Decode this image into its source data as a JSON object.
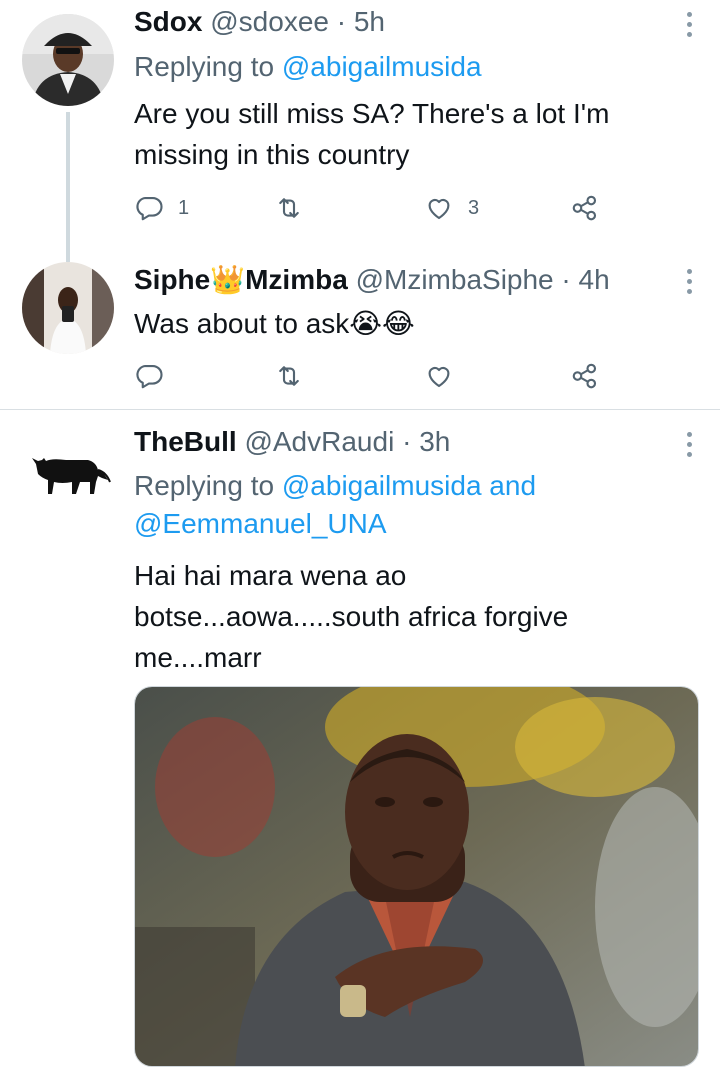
{
  "tweets": [
    {
      "name": "Sdox",
      "handle": "@sdoxee",
      "separator": "·",
      "time": "5h",
      "replying_prefix": "Replying to",
      "replying_to": "@abigailmusida",
      "text_line1": "Are you still miss SA? There's a lot I'm",
      "text_line2": "missing in this country",
      "reply_count": "1",
      "retweet_count": "",
      "like_count": "3"
    },
    {
      "name_part1": "Siphe",
      "name_part2": "Mzimba",
      "handle": "@MzimbaSiphe",
      "separator": "·",
      "time": "4h",
      "text": "Was about to ask😭😂"
    },
    {
      "name": "TheBull",
      "handle": "@AdvRaudi",
      "separator": "·",
      "time": "3h",
      "replying_prefix": "Replying to",
      "replying_to": "@abigailmusida",
      "replying_joiner": "and",
      "replying_to_2": "@Eemmanuel_UNA",
      "text_line1": "Hai hai mara wena ao",
      "text_line2": "botse...aowa.....south africa forgive",
      "text_line3": "me....marr"
    }
  ],
  "icons": {
    "reply": "reply-icon",
    "retweet": "retweet-icon",
    "like": "heart-icon",
    "share": "share-icon",
    "more": "more-vertical-icon"
  },
  "colors": {
    "link": "#1d9bf0",
    "secondary_text": "#536471",
    "thread_line": "#cfd9de"
  }
}
